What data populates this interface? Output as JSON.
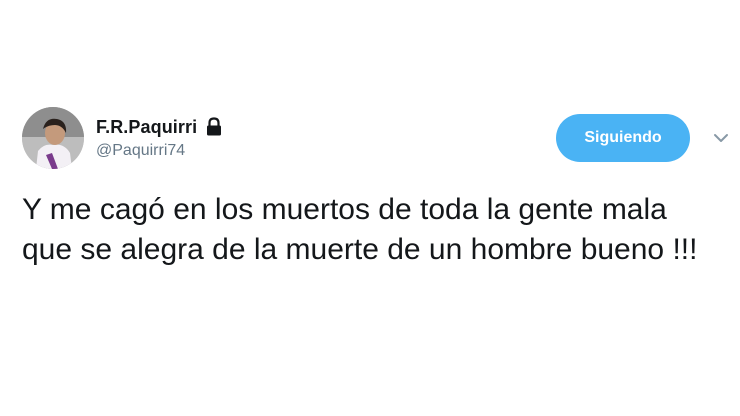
{
  "user": {
    "display_name": "F.R.Paquirri",
    "handle": "@Paquirri74",
    "protected_icon": "lock-icon",
    "avatar_icon": "avatar"
  },
  "actions": {
    "follow_label": "Siguiendo",
    "menu_icon": "chevron-down-icon"
  },
  "tweet": {
    "text": "Y me cagó en los muertos de toda la gente mala que se alegra de la muerte de un hombre bueno !!!"
  },
  "colors": {
    "accent": "#4ab3f4",
    "text": "#14171a",
    "secondary_text": "#657786"
  }
}
